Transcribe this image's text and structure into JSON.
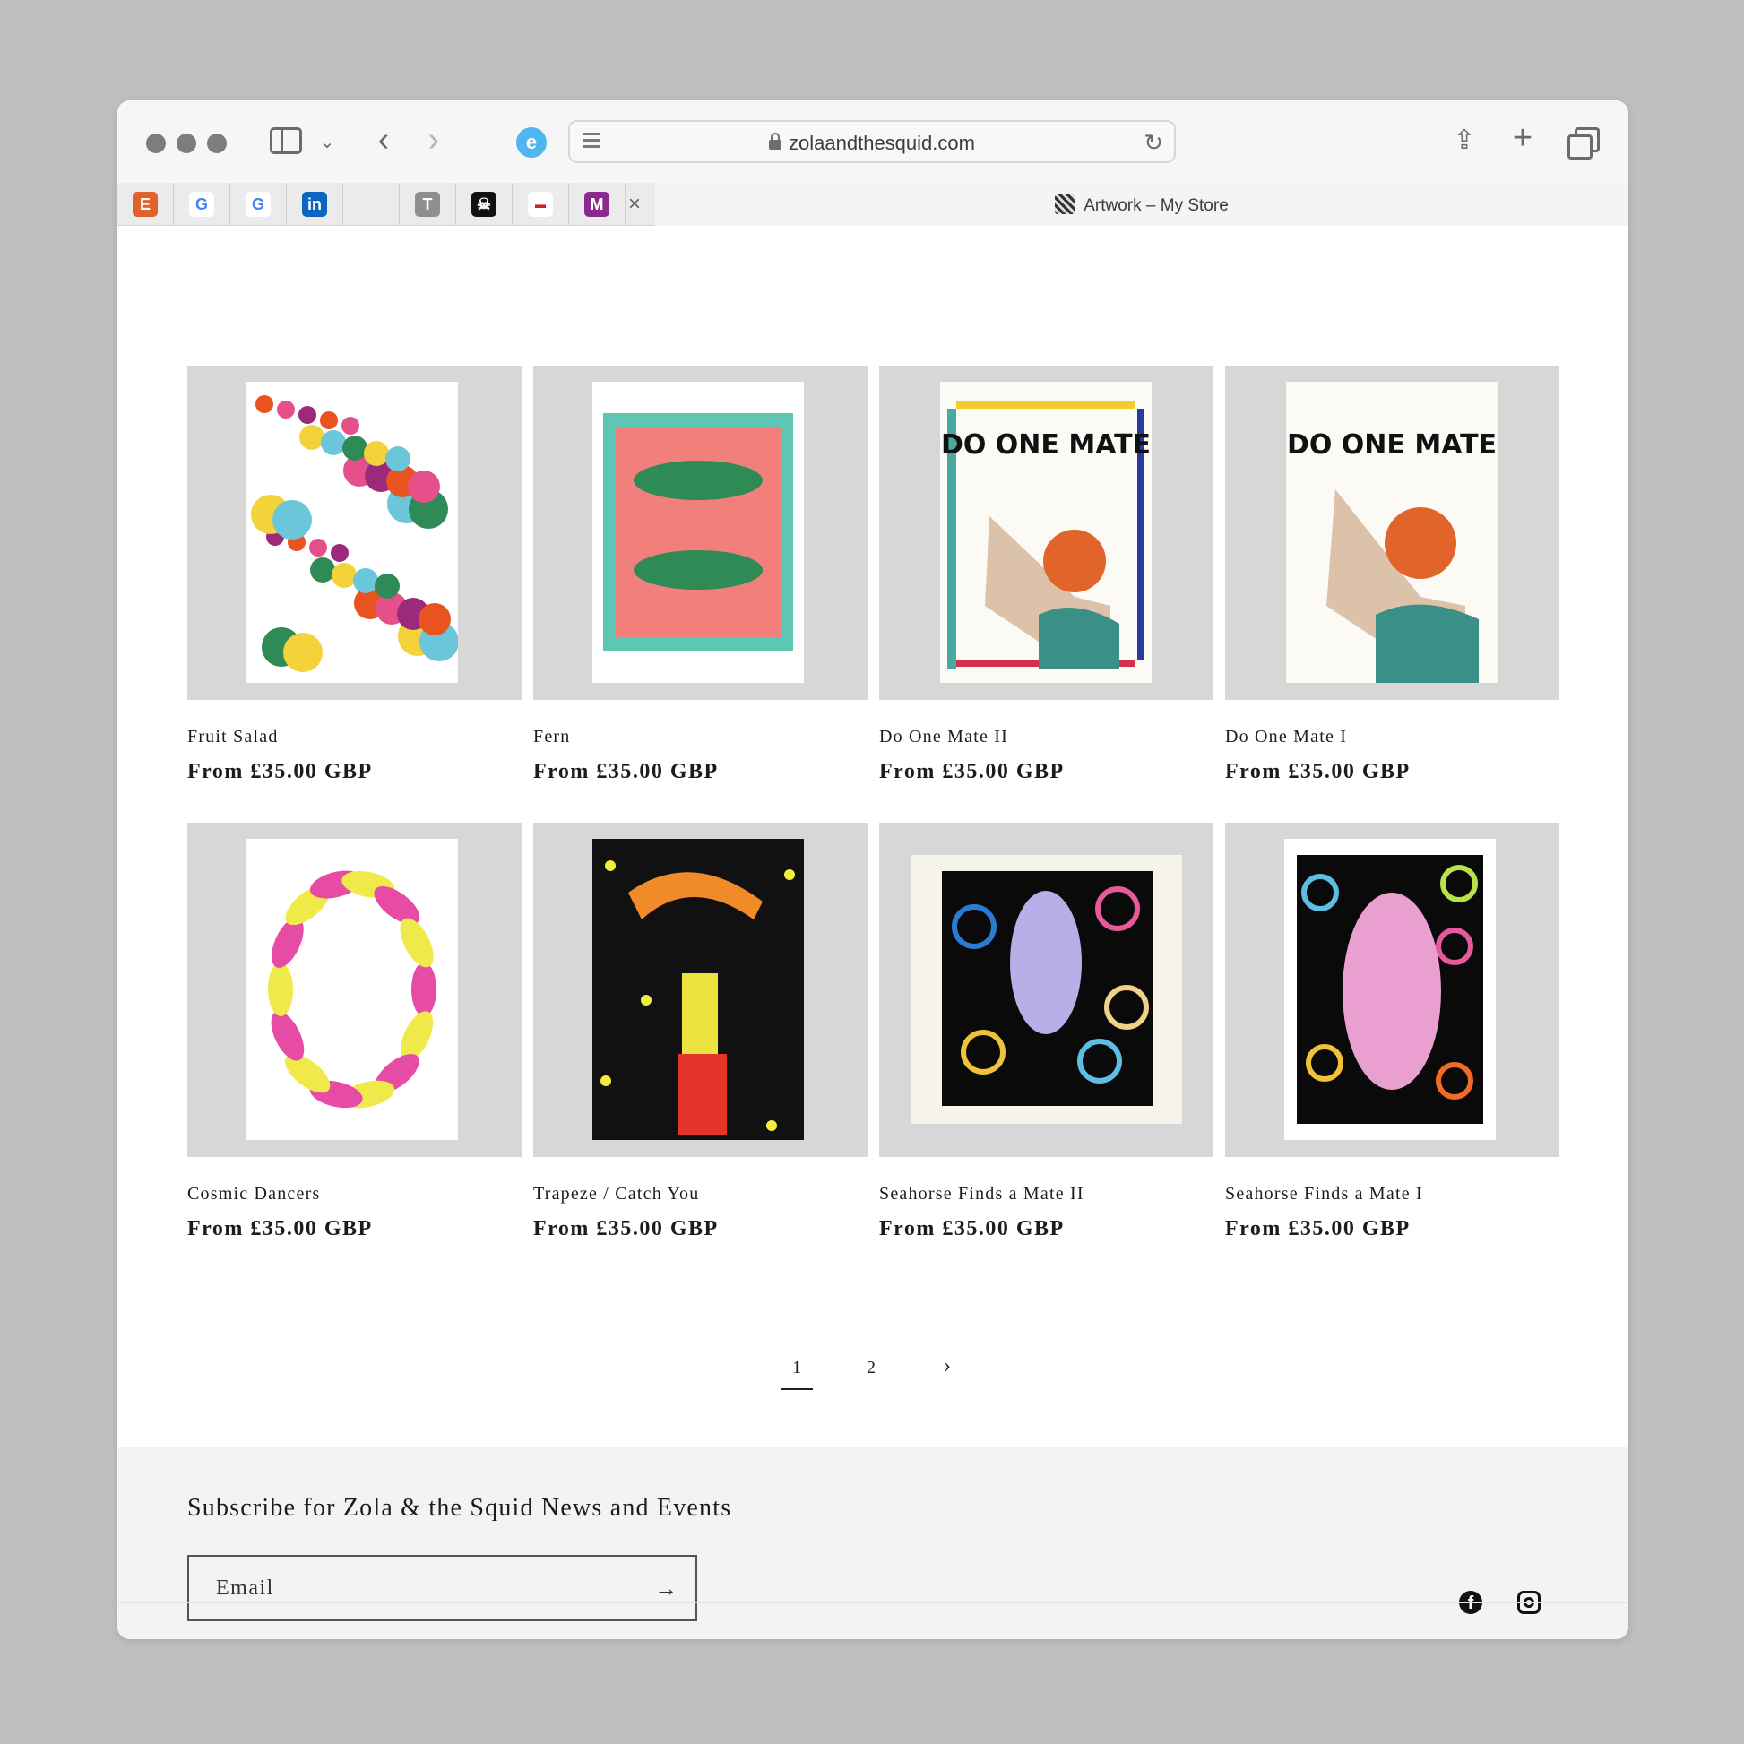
{
  "browser": {
    "url": "zolaandthesquid.com",
    "active_tab_title": "Artwork – My Store",
    "pinned_tabs": [
      {
        "icon": "etsy-icon",
        "glyph": "E",
        "color": "#e1622a"
      },
      {
        "icon": "google-icon",
        "glyph": "G",
        "color": "#ffffff"
      },
      {
        "icon": "google-icon",
        "glyph": "G",
        "color": "#ffffff"
      },
      {
        "icon": "linkedin-icon",
        "glyph": "in",
        "color": "#0a66c2"
      },
      {
        "icon": "apple-icon",
        "glyph": "",
        "color": "#ebebeb"
      },
      {
        "icon": "t-app-icon",
        "glyph": "T",
        "color": "#8f8f8f"
      },
      {
        "icon": "pirate-flag-icon",
        "glyph": "☠",
        "color": "#111111"
      },
      {
        "icon": "royal-mail-icon",
        "glyph": "▬",
        "color": "#ffffff"
      },
      {
        "icon": "purple-app-icon",
        "glyph": "M",
        "color": "#8a2a8f"
      }
    ]
  },
  "products": [
    {
      "title": "Fruit Salad",
      "price": "From £35.00 GBP"
    },
    {
      "title": "Fern",
      "price": "From £35.00 GBP"
    },
    {
      "title": "Do One Mate II",
      "price": "From £35.00 GBP"
    },
    {
      "title": "Do One Mate I",
      "price": "From £35.00 GBP"
    },
    {
      "title": "Cosmic Dancers",
      "price": "From £35.00 GBP"
    },
    {
      "title": "Trapeze / Catch You",
      "price": "From £35.00 GBP"
    },
    {
      "title": "Seahorse Finds a Mate II",
      "price": "From £35.00 GBP"
    },
    {
      "title": "Seahorse Finds a Mate I",
      "price": "From £35.00 GBP"
    }
  ],
  "artwork_text": {
    "do_one_mate": "DO ONE MATE"
  },
  "pagination": {
    "current": "1",
    "next_page": "2",
    "next_icon": "›"
  },
  "footer": {
    "subscribe_title": "Subscribe for Zola & the Squid News and Events",
    "email_placeholder": "Email",
    "submit_icon": "→"
  }
}
